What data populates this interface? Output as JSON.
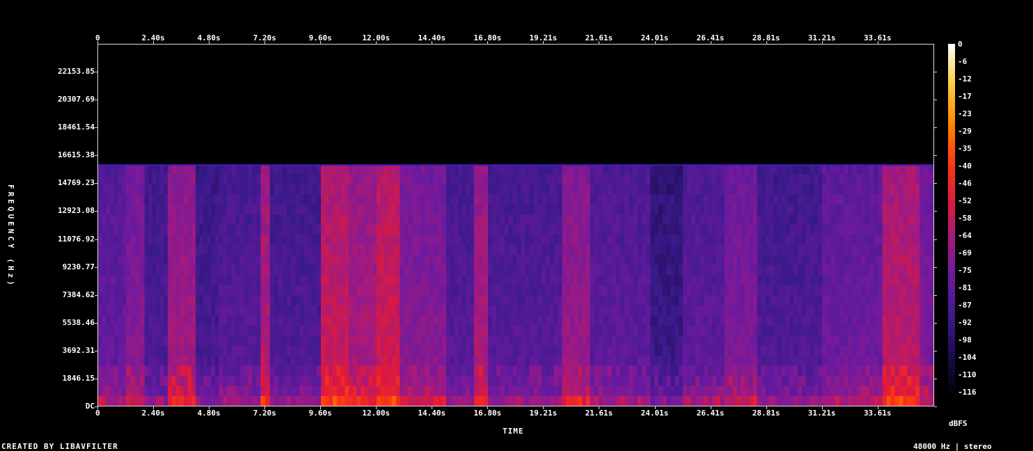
{
  "chart_data": {
    "type": "heatmap",
    "title": "",
    "xlabel": "TIME",
    "ylabel": "FREQUENCY (Hz)",
    "colorbar_label": "dBFS",
    "x_ticks": [
      "0",
      "2.40s",
      "4.80s",
      "7.20s",
      "9.60s",
      "12.00s",
      "14.40s",
      "16.80s",
      "19.21s",
      "21.61s",
      "24.01s",
      "26.41s",
      "28.81s",
      "31.21s",
      "33.61s"
    ],
    "y_ticks": [
      "22153.85",
      "20307.69",
      "18461.54",
      "16615.38",
      "14769.23",
      "12923.08",
      "11076.92",
      "9230.77",
      "7384.62",
      "5538.46",
      "3692.31",
      "1846.15",
      "DC"
    ],
    "y_tick_values": [
      22153.85,
      20307.69,
      18461.54,
      16615.38,
      14769.23,
      12923.08,
      11076.92,
      9230.77,
      7384.62,
      5538.46,
      3692.31,
      1846.15,
      0
    ],
    "colorbar_ticks": [
      "0",
      "-6",
      "-12",
      "-17",
      "-23",
      "-29",
      "-35",
      "-40",
      "-46",
      "-52",
      "-58",
      "-64",
      "-69",
      "-75",
      "-81",
      "-87",
      "-92",
      "-98",
      "-104",
      "-110",
      "-116"
    ],
    "xlim": [
      0,
      36
    ],
    "ylim": [
      0,
      24000
    ],
    "content_cutoff_hz": 16000,
    "colormap": [
      "#000000",
      "#1a0a4a",
      "#3a1a8a",
      "#6a1aa0",
      "#a01a80",
      "#e01a3a",
      "#ff3a10",
      "#ff8a00",
      "#ffd040",
      "#ffffff"
    ],
    "time_segments": [
      {
        "t0": 0.0,
        "t1": 1.2,
        "level": -80
      },
      {
        "t0": 1.2,
        "t1": 2.0,
        "level": -72
      },
      {
        "t0": 2.0,
        "t1": 3.0,
        "level": -86
      },
      {
        "t0": 3.0,
        "t1": 4.2,
        "level": -66
      },
      {
        "t0": 4.2,
        "t1": 5.2,
        "level": -88
      },
      {
        "t0": 5.2,
        "t1": 7.0,
        "level": -84
      },
      {
        "t0": 7.0,
        "t1": 7.4,
        "level": -62
      },
      {
        "t0": 7.4,
        "t1": 9.6,
        "level": -86
      },
      {
        "t0": 9.6,
        "t1": 10.8,
        "level": -58
      },
      {
        "t0": 10.8,
        "t1": 12.0,
        "level": -64
      },
      {
        "t0": 12.0,
        "t1": 13.0,
        "level": -56
      },
      {
        "t0": 13.0,
        "t1": 15.0,
        "level": -72
      },
      {
        "t0": 15.0,
        "t1": 16.2,
        "level": -84
      },
      {
        "t0": 16.2,
        "t1": 16.8,
        "level": -64
      },
      {
        "t0": 16.8,
        "t1": 20.0,
        "level": -84
      },
      {
        "t0": 20.0,
        "t1": 21.2,
        "level": -68
      },
      {
        "t0": 21.2,
        "t1": 23.8,
        "level": -82
      },
      {
        "t0": 23.8,
        "t1": 25.2,
        "level": -92
      },
      {
        "t0": 25.2,
        "t1": 27.0,
        "level": -82
      },
      {
        "t0": 27.0,
        "t1": 28.4,
        "level": -74
      },
      {
        "t0": 28.4,
        "t1": 31.2,
        "level": -86
      },
      {
        "t0": 31.2,
        "t1": 33.8,
        "level": -78
      },
      {
        "t0": 33.8,
        "t1": 35.4,
        "level": -60
      },
      {
        "t0": 35.4,
        "t1": 36.0,
        "level": -74
      }
    ]
  },
  "footer": {
    "credit": "CREATED BY LIBAVFILTER",
    "info": "48000 Hz | stereo"
  }
}
